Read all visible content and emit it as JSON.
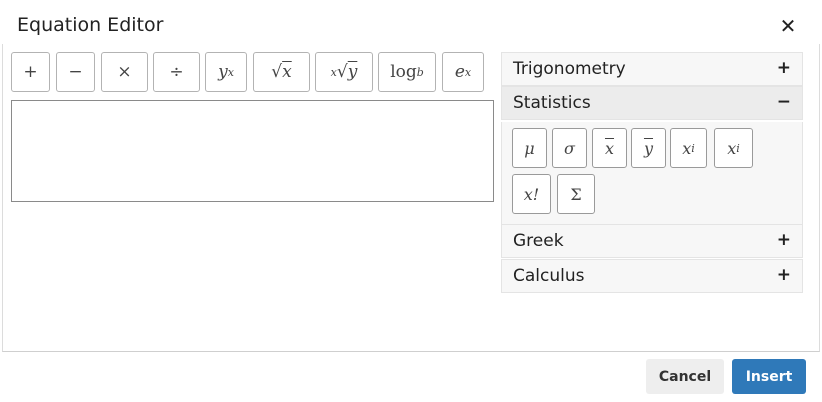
{
  "dialog": {
    "title": "Equation Editor",
    "close_glyph": "✕"
  },
  "toolbar": {
    "buttons": [
      {
        "name": "plus",
        "glyph": "+"
      },
      {
        "name": "minus",
        "glyph": "−"
      },
      {
        "name": "times",
        "glyph": "×"
      },
      {
        "name": "divide",
        "glyph": "÷"
      },
      {
        "name": "power",
        "base": "y",
        "sup": "x"
      },
      {
        "name": "sqrt",
        "radical": "√",
        "arg": "x"
      },
      {
        "name": "nth-root",
        "index": "x",
        "radical": "√",
        "arg": "y"
      },
      {
        "name": "log",
        "base": "log",
        "sub": "b"
      },
      {
        "name": "exp",
        "base": "e",
        "sup": "x"
      }
    ]
  },
  "editor": {
    "value": ""
  },
  "panel": {
    "sections": [
      {
        "label": "Trigonometry",
        "sign": "+",
        "state": "collapsed"
      },
      {
        "label": "Statistics",
        "sign": "−",
        "state": "expanded"
      },
      {
        "label": "Greek",
        "sign": "+",
        "state": "collapsed"
      },
      {
        "label": "Calculus",
        "sign": "+",
        "state": "collapsed"
      }
    ],
    "statistics_buttons": [
      {
        "name": "mu",
        "glyph": "μ"
      },
      {
        "name": "sigma",
        "glyph": "σ"
      },
      {
        "name": "x-bar",
        "glyph": "x"
      },
      {
        "name": "y-bar",
        "glyph": "y"
      },
      {
        "name": "x-sup-i",
        "base": "x",
        "sup": "i"
      },
      {
        "name": "x-sub-i",
        "base": "x",
        "sub": "i"
      },
      {
        "name": "factorial",
        "glyph": "x!"
      },
      {
        "name": "summation",
        "glyph": "Σ"
      }
    ]
  },
  "footer": {
    "cancel_label": "Cancel",
    "insert_label": "Insert"
  },
  "colors": {
    "accent": "#2f79b9",
    "cancel_bg": "#eeeeee",
    "panel_bg": "#f7f7f7"
  }
}
